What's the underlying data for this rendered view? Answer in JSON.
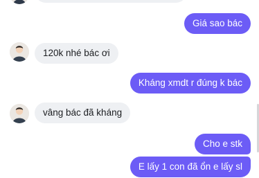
{
  "messages": [
    {
      "from": "them",
      "text": "",
      "partial": true
    },
    {
      "from": "me",
      "text": "Giá sao bác"
    },
    {
      "from": "them",
      "text": "120k nhé bác ơi"
    },
    {
      "from": "me",
      "text": "Kháng xmdt r đúng k bác"
    },
    {
      "from": "them",
      "text": "vâng bác đã kháng"
    },
    {
      "from": "me",
      "text": "Cho e stk"
    },
    {
      "from": "me",
      "text": "E lấy 1 con đã ổn e lấy sl"
    }
  ],
  "avatar_icon": "person-avatar-icon",
  "colors": {
    "outgoing_bubble": "#6c5cf6",
    "incoming_bubble": "#eef0f3",
    "background": "#ffffff"
  }
}
